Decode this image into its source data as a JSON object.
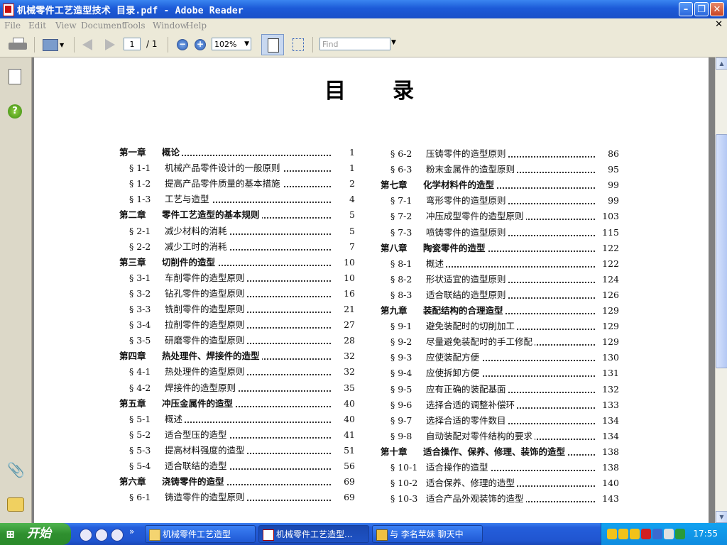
{
  "window": {
    "title": "机械零件工艺造型技术 目录.pdf - Adobe Reader"
  },
  "menu": [
    "File",
    "Edit",
    "View",
    "Document",
    "Tools",
    "Window",
    "Help"
  ],
  "toolbar": {
    "page_value": "1",
    "page_total": "/ 1",
    "zoom": "102%",
    "find_placeholder": "Find",
    "zoom_out": "−",
    "zoom_in": "+"
  },
  "document": {
    "title": "目录",
    "toc_left": [
      {
        "sec": "第一章",
        "label": "概论",
        "page": "1",
        "chapter": true
      },
      {
        "sec": "§ 1-1",
        "label": "机械产品零件设计的一般原则",
        "page": "1"
      },
      {
        "sec": "§ 1-2",
        "label": "提高产品零件质量的基本措施",
        "page": "2"
      },
      {
        "sec": "§ 1-3",
        "label": "工艺与造型",
        "page": "4"
      },
      {
        "sec": "第二章",
        "label": "零件工艺造型的基本规则",
        "page": "5",
        "chapter": true
      },
      {
        "sec": "§ 2-1",
        "label": "减少材料的消耗",
        "page": "5"
      },
      {
        "sec": "§ 2-2",
        "label": "减少工时的消耗",
        "page": "7"
      },
      {
        "sec": "第三章",
        "label": "切削件的造型",
        "page": "10",
        "chapter": true
      },
      {
        "sec": "§ 3-1",
        "label": "车削零件的造型原则",
        "page": "10"
      },
      {
        "sec": "§ 3-2",
        "label": "钻孔零件的造型原则",
        "page": "16"
      },
      {
        "sec": "§ 3-3",
        "label": "铣削零件的造型原则",
        "page": "21"
      },
      {
        "sec": "§ 3-4",
        "label": "拉削零件的造型原则",
        "page": "27"
      },
      {
        "sec": "§ 3-5",
        "label": "研磨零件的造型原则",
        "page": "28"
      },
      {
        "sec": "第四章",
        "label": "热处理件、焊接件的造型",
        "page": "32",
        "chapter": true
      },
      {
        "sec": "§ 4-1",
        "label": "热处理件的造型原则",
        "page": "32"
      },
      {
        "sec": "§ 4-2",
        "label": "焊接件的造型原则",
        "page": "35"
      },
      {
        "sec": "第五章",
        "label": "冲压金属件的造型",
        "page": "40",
        "chapter": true
      },
      {
        "sec": "§ 5-1",
        "label": "概述",
        "page": "40"
      },
      {
        "sec": "§ 5-2",
        "label": "适合型压的造型",
        "page": "41"
      },
      {
        "sec": "§ 5-3",
        "label": "提高材料强度的造型",
        "page": "51"
      },
      {
        "sec": "§ 5-4",
        "label": "适合联结的造型",
        "page": "56"
      },
      {
        "sec": "第六章",
        "label": "浇铸零件的造型",
        "page": "69",
        "chapter": true
      },
      {
        "sec": "§ 6-1",
        "label": "铸造零件的造型原则",
        "page": "69"
      }
    ],
    "toc_right": [
      {
        "sec": "§ 6-2",
        "label": "压铸零件的造型原则",
        "page": "86"
      },
      {
        "sec": "§ 6-3",
        "label": "粉末金属件的造型原则",
        "page": "95"
      },
      {
        "sec": "第七章",
        "label": "化学材料件的造型",
        "page": "99",
        "chapter": true
      },
      {
        "sec": "§ 7-1",
        "label": "弯形零件的造型原则",
        "page": "99"
      },
      {
        "sec": "§ 7-2",
        "label": "冲压成型零件的造型原则",
        "page": "103"
      },
      {
        "sec": "§ 7-3",
        "label": "喷铸零件的造型原则",
        "page": "115"
      },
      {
        "sec": "第八章",
        "label": "陶瓷零件的造型",
        "page": "122",
        "chapter": true
      },
      {
        "sec": "§ 8-1",
        "label": "概述",
        "page": "122"
      },
      {
        "sec": "§ 8-2",
        "label": "形状适宜的造型原则",
        "page": "124"
      },
      {
        "sec": "§ 8-3",
        "label": "适合联结的造型原则",
        "page": "126"
      },
      {
        "sec": "第九章",
        "label": "装配结构的合理造型",
        "page": "129",
        "chapter": true
      },
      {
        "sec": "§ 9-1",
        "label": "避免装配时的切削加工",
        "page": "129"
      },
      {
        "sec": "§ 9-2",
        "label": "尽量避免装配时的手工修配",
        "page": "129"
      },
      {
        "sec": "§ 9-3",
        "label": "应使装配方便",
        "page": "130"
      },
      {
        "sec": "§ 9-4",
        "label": "应使拆卸方便",
        "page": "131"
      },
      {
        "sec": "§ 9-5",
        "label": "应有正确的装配基面",
        "page": "132"
      },
      {
        "sec": "§ 9-6",
        "label": "选择合适的调整补偿环",
        "page": "133"
      },
      {
        "sec": "§ 9-7",
        "label": "选择合适的零件数目",
        "page": "134"
      },
      {
        "sec": "§ 9-8",
        "label": "自动装配对零件结构的要求",
        "page": "134"
      },
      {
        "sec": "第十章",
        "label": "适合操作、保养、修理、装饰的造型",
        "page": "138",
        "chapter": true
      },
      {
        "sec": "§ 10-1",
        "label": "适合操作的造型",
        "page": "138"
      },
      {
        "sec": "§ 10-2",
        "label": "适合保养、修理的造型",
        "page": "140"
      },
      {
        "sec": "§ 10-3",
        "label": "适合产品外观装饰的造型",
        "page": "143"
      }
    ]
  },
  "taskbar": {
    "start_label": "开始",
    "tasks": [
      {
        "label": "机械零件工艺造型",
        "icon": "folder-icon"
      },
      {
        "label": "机械零件工艺造型...",
        "icon": "pdf-icon",
        "active": true
      },
      {
        "label": "与 李名苹妹 聊天中",
        "icon": "chat-icon"
      }
    ],
    "clock": "17:55"
  }
}
